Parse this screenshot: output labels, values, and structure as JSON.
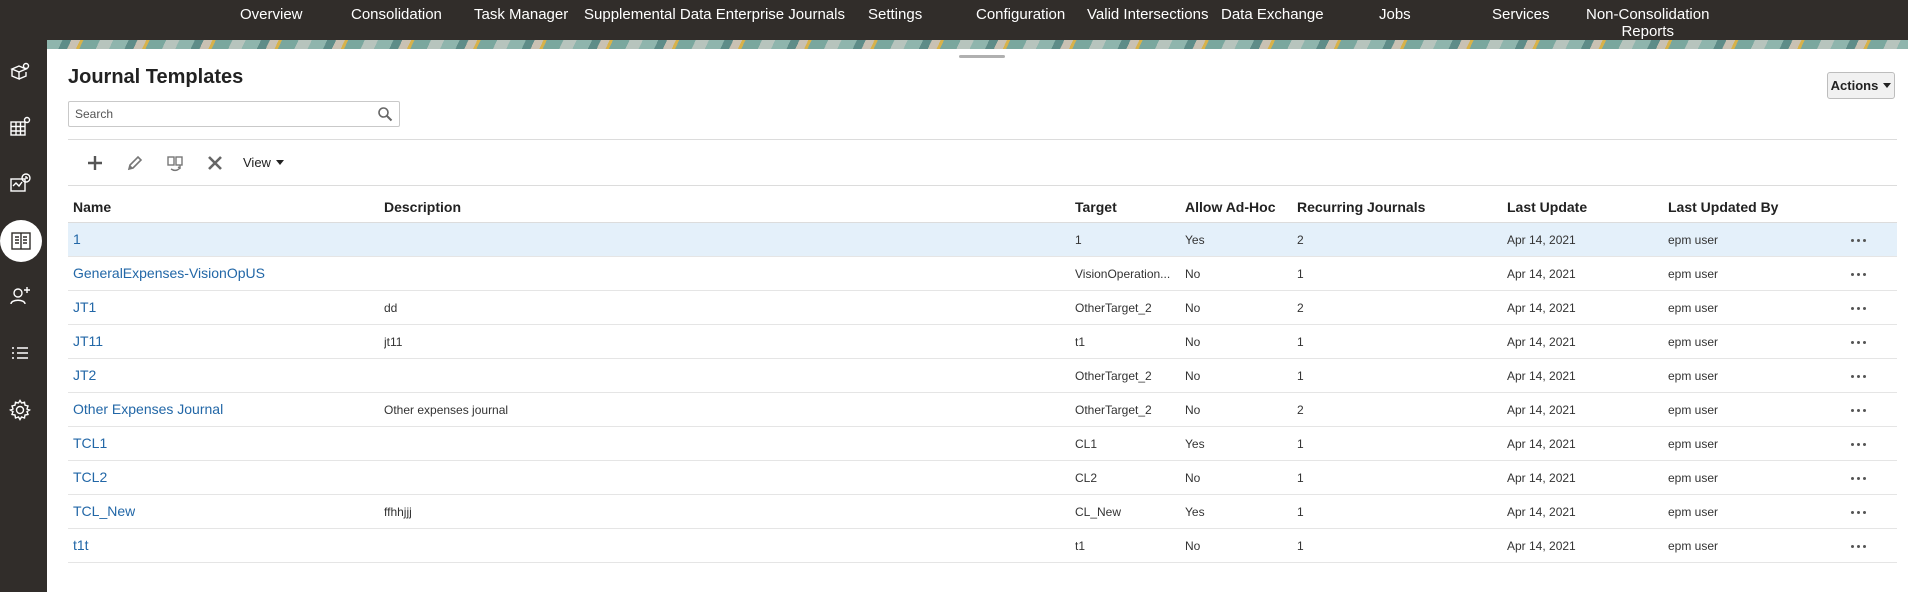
{
  "topnav": {
    "items": [
      "Overview",
      "Consolidation",
      "Task Manager",
      "Supplemental Data Enterprise Journals",
      "Settings",
      "Configuration",
      "Valid Intersections",
      "Data Exchange",
      "Jobs",
      "Services",
      "Non-Consolidation",
      "Reports"
    ]
  },
  "rail": {
    "icons": [
      "cube-location-icon",
      "table-settings-icon",
      "task-schedule-icon",
      "book-icon",
      "add-user-icon",
      "list-icon",
      "gear-icon"
    ],
    "active": "book-icon"
  },
  "page": {
    "title": "Journal Templates",
    "actions_label": "Actions"
  },
  "search": {
    "placeholder": "Search",
    "value": ""
  },
  "toolbar": {
    "tools": [
      "add-icon",
      "edit-icon",
      "copy-icon",
      "delete-icon"
    ],
    "view_label": "View"
  },
  "table": {
    "headers": {
      "name": "Name",
      "description": "Description",
      "target": "Target",
      "adhoc": "Allow Ad-Hoc",
      "recurring": "Recurring Journals",
      "last_update": "Last Update",
      "updated_by": "Last Updated By"
    },
    "rows": [
      {
        "name": "1",
        "description": "",
        "target": "1",
        "adhoc": "Yes",
        "recurring": "2",
        "last_update": "Apr 14, 2021",
        "updated_by": "epm user"
      },
      {
        "name": "GeneralExpenses-VisionOpUS",
        "description": "",
        "target": "VisionOperation...",
        "adhoc": "No",
        "recurring": "1",
        "last_update": "Apr 14, 2021",
        "updated_by": "epm user"
      },
      {
        "name": "JT1",
        "description": "dd",
        "target": "OtherTarget_2",
        "adhoc": "No",
        "recurring": "2",
        "last_update": "Apr 14, 2021",
        "updated_by": "epm user"
      },
      {
        "name": "JT11",
        "description": "jt11",
        "target": "t1",
        "adhoc": "No",
        "recurring": "1",
        "last_update": "Apr 14, 2021",
        "updated_by": "epm user"
      },
      {
        "name": "JT2",
        "description": "",
        "target": "OtherTarget_2",
        "adhoc": "No",
        "recurring": "1",
        "last_update": "Apr 14, 2021",
        "updated_by": "epm user"
      },
      {
        "name": "Other Expenses Journal",
        "description": "Other expenses journal",
        "target": "OtherTarget_2",
        "adhoc": "No",
        "recurring": "2",
        "last_update": "Apr 14, 2021",
        "updated_by": "epm user"
      },
      {
        "name": "TCL1",
        "description": "",
        "target": "CL1",
        "adhoc": "Yes",
        "recurring": "1",
        "last_update": "Apr 14, 2021",
        "updated_by": "epm user"
      },
      {
        "name": "TCL2",
        "description": "",
        "target": "CL2",
        "adhoc": "No",
        "recurring": "1",
        "last_update": "Apr 14, 2021",
        "updated_by": "epm user"
      },
      {
        "name": "TCL_New",
        "description": "ffhhjjj",
        "target": "CL_New",
        "adhoc": "Yes",
        "recurring": "1",
        "last_update": "Apr 14, 2021",
        "updated_by": "epm user"
      },
      {
        "name": "t1t",
        "description": "",
        "target": "t1",
        "adhoc": "No",
        "recurring": "1",
        "last_update": "Apr 14, 2021",
        "updated_by": "epm user"
      }
    ],
    "selected_row": 0
  },
  "colors": {
    "nav_bg": "#312d2a",
    "link": "#2267a7",
    "selected_row": "#e4f0fa"
  }
}
